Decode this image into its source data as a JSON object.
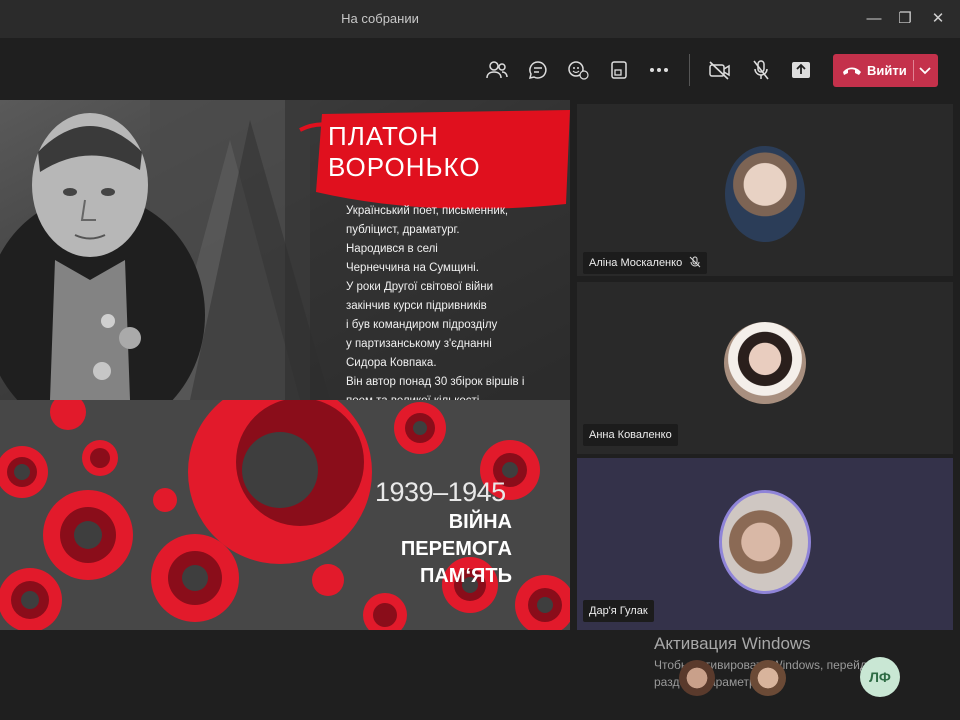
{
  "window": {
    "title": "На собрании"
  },
  "toolbar": {
    "leave_label": "Вийти",
    "icons": [
      "participants-icon",
      "chat-icon",
      "reactions-icon",
      "share-tray-icon",
      "more-icon",
      "camera-off-icon",
      "mic-off-icon",
      "share-screen-icon"
    ]
  },
  "slide": {
    "name_line1": "ПЛАТОН",
    "name_line2": "ВОРОНЬКО",
    "bio_lines": [
      "Український поет, письменник,",
      "публіцист,  драматург.",
      "Народився в селі",
      "Чернеччина на Сумщині.",
      "У роки Другої світової війни",
      "закінчив курси підривників",
      "і був командиром підрозділу",
      " у партизанському з'єднанні",
      "Сидора Ковпака.",
      "Він автор понад 30 збірок віршів і",
      "поем  та великої кількості"
    ],
    "years": "1939–1945",
    "slogan_1": "ВІЙНА",
    "slogan_2": "ПЕРЕМОГА",
    "slogan_3": "ПАМ‘ЯТЬ"
  },
  "participants": [
    {
      "name": "Аліна Москаленко",
      "muted": true
    },
    {
      "name": "Анна Коваленко",
      "muted": false
    },
    {
      "name": "Дар'я Гулак",
      "muted": false,
      "speaking": true
    }
  ],
  "watermark": {
    "title": "Активация Windows",
    "text": "Чтобы активировать Windows, перейдите в раздел \"Параметры\"."
  },
  "overflow": {
    "initials": "ЛФ"
  },
  "colors": {
    "accent_red": "#c4314b",
    "poster_red": "#e0101e",
    "speaking_ring": "#8f84d8"
  }
}
